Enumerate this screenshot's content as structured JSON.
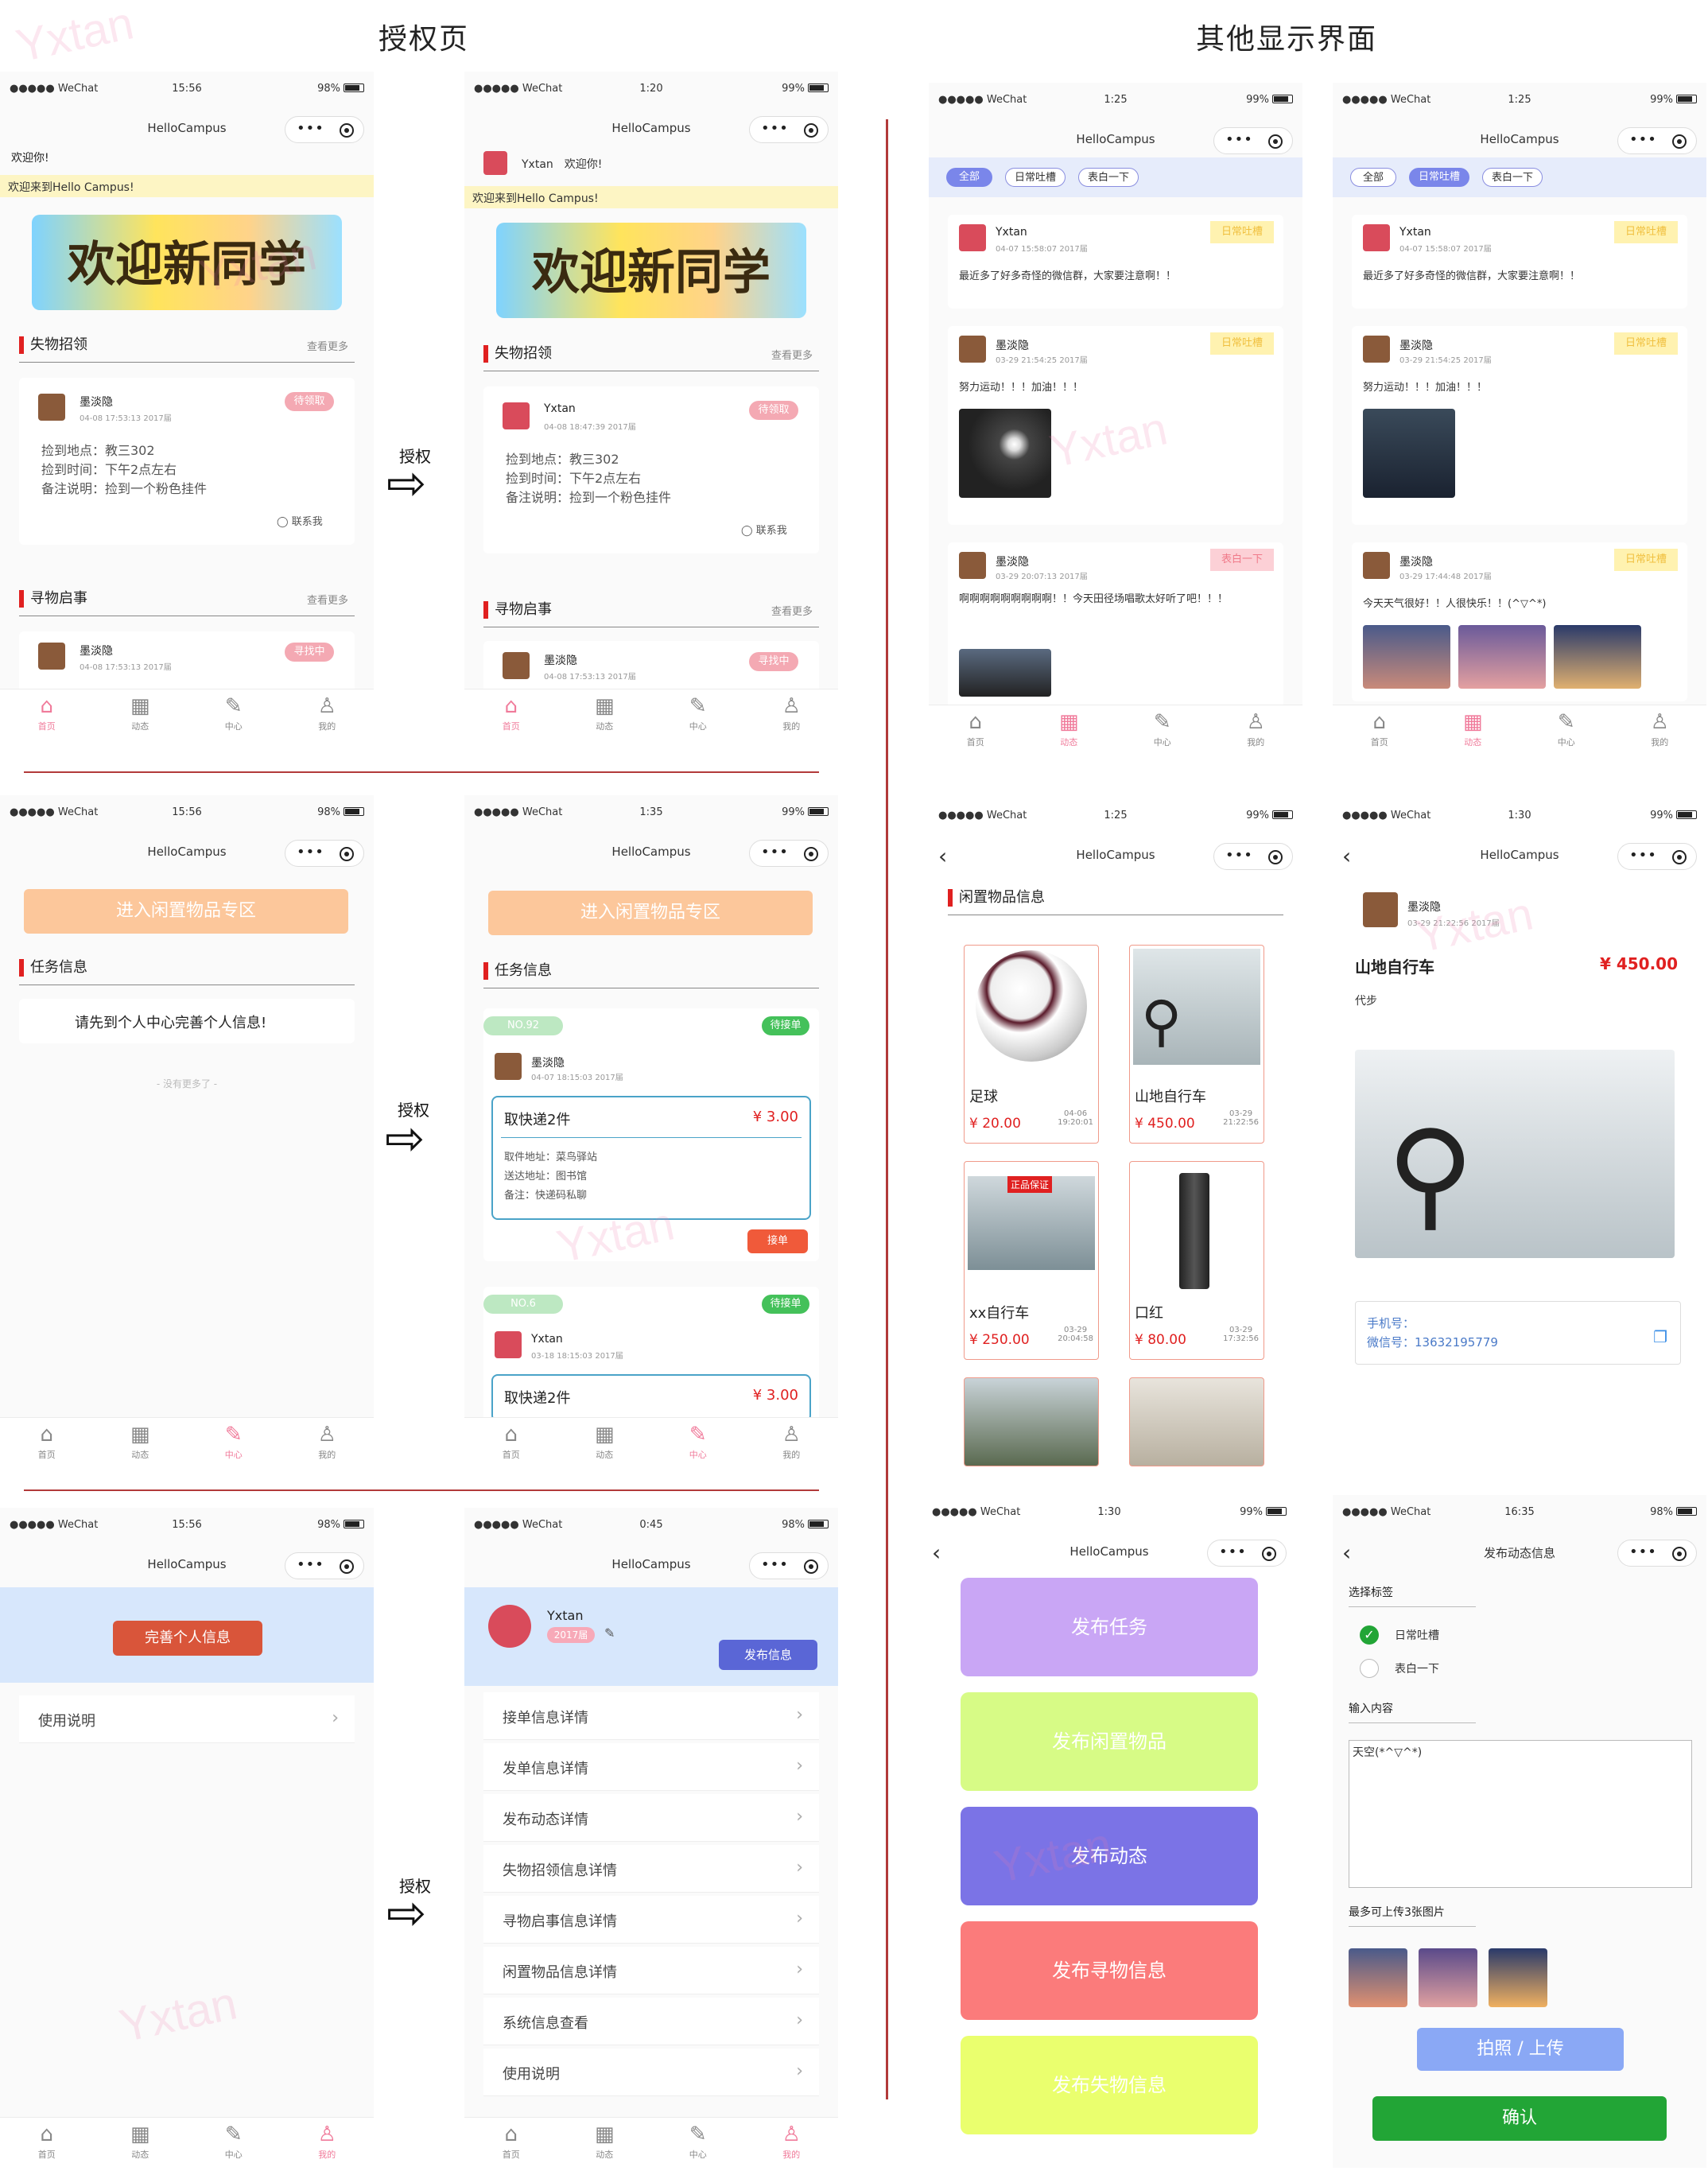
{
  "headings": {
    "auth": "授权页",
    "other": "其他显示界面"
  },
  "auth_label": "授权",
  "status": {
    "carrier": "●●●●● WeChat",
    "battery98": "98%",
    "battery99": "99%",
    "t1": "15:56",
    "t2": "1:20",
    "t3": "1:25",
    "t4": "1:35",
    "t5": "1:30",
    "t6": "0:45",
    "t7": "16:35"
  },
  "app_title": "HelloCampus",
  "tabs": {
    "home": "首页",
    "feed": "动态",
    "center": "中心",
    "mine": "我的"
  },
  "home": {
    "hello": "欢迎你!",
    "welcome": "欢迎来到Hello Campus!",
    "banner": "欢迎新同学",
    "lost_title": "失物招领",
    "find_title": "寻物启事",
    "more": "查看更多",
    "lost_user": "墨淡隐",
    "lost_time": "04-08 17:53:13 2017届",
    "lost_status": "待领取",
    "lost_place": "捡到地点：教三302",
    "lost_when": "捡到时间：下午2点左右",
    "lost_note": "备注说明：捡到一个粉色挂件",
    "contact": "联系我",
    "find_user": "墨淡隐",
    "find_time": "04-08 17:53:13 2017届",
    "find_status": "寻找中",
    "auth_user": "Yxtan",
    "auth_lost_time": "04-08 18:47:39 2017届",
    "auth_find_time": "04-08 17:53:13 2017届"
  },
  "feed": {
    "filter_all": "全部",
    "filter_daily": "日常吐槽",
    "filter_confess": "表白一下",
    "p1_user": "Yxtan",
    "p1_time": "04-07 15:58:07 2017届",
    "p1_tag": "日常吐槽",
    "p1_text": "最近多了好多奇怪的微信群，大家要注意啊！！",
    "p2_user": "墨淡隐",
    "p2_time": "03-29 21:54:25 2017届",
    "p2_tag": "日常吐槽",
    "p2_text": "努力运动！！！加油！！！",
    "p3_user": "墨淡隐",
    "p3_time": "03-29 20:07:13 2017届",
    "p3_tag": "表白一下",
    "p3_text": "啊啊啊啊啊啊啊啊啊！！今天田径场唱歌太好听了吧！！！",
    "p4_user": "墨淡隐",
    "p4_time": "03-29 17:44:48 2017届",
    "p4_tag": "日常吐槽",
    "p4_text": "今天天气很好！！人很快乐！！(^▽^*)"
  },
  "task": {
    "idle_btn": "进入闲置物品专区",
    "task_title": "任务信息",
    "hint": "请先到个人中心完善个人信息!",
    "no_more": "- 没有更多了 -",
    "no1": "NO.92",
    "st1": "待接单",
    "u1": "墨淡隐",
    "t1": "04-07 18:15:03 2017届",
    "n1": "取快递2件",
    "p1": "¥ 3.00",
    "from": "取件地址：菜鸟驿站",
    "to": "送达地址：图书馆",
    "note": "备注：快递码私聊",
    "accept": "接单",
    "no2": "NO.6",
    "st2": "待接单",
    "u2": "Yxtan",
    "t2": "03-18 18:15:03 2017届",
    "n2": "取快递2件",
    "p2": "¥ 3.00"
  },
  "idle": {
    "title": "闲置物品信息",
    "items": [
      {
        "name": "足球",
        "price": "¥ 20.00",
        "date": "04-06",
        "time": "19:20:01"
      },
      {
        "name": "山地自行车",
        "price": "¥ 450.00",
        "date": "03-29",
        "time": "21:22:56"
      },
      {
        "name": "xx自行车",
        "price": "¥ 250.00",
        "date": "03-29",
        "time": "20:04:58"
      },
      {
        "name": "口红",
        "price": "¥ 80.00",
        "date": "03-29",
        "time": "17:32:56"
      }
    ],
    "tag": "正品保证"
  },
  "detail": {
    "user": "墨淡隐",
    "time": "03-29 21:22:56 2017届",
    "title": "山地自行车",
    "price": "¥ 450.00",
    "desc": "代步",
    "phone": "手机号：",
    "wechat": "微信号：13632195779"
  },
  "mine": {
    "complete": "完善个人信息",
    "manual": "使用说明",
    "user": "Yxtan",
    "grade": "2017届",
    "publish": "发布信息",
    "rows": [
      "接单信息详情",
      "发单信息详情",
      "发布动态详情",
      "失物招领信息详情",
      "寻物启事信息详情",
      "闲置物品信息详情",
      "系统信息查看",
      "使用说明"
    ]
  },
  "publish": {
    "b1": "发布任务",
    "b2": "发布闲置物品",
    "b3": "发布动态",
    "b4": "发布寻物信息",
    "b5": "发布失物信息"
  },
  "post": {
    "nav": "发布动态信息",
    "choose": "选择标签",
    "opt1": "日常吐槽",
    "opt2": "表白一下",
    "input": "输入内容",
    "content": "天空(*^▽^*)",
    "upload_hint": "最多可上传3张图片",
    "upload": "拍照 / 上传",
    "confirm": "确认"
  },
  "watermark": "Yxtan",
  "colors": {
    "accent": "#f07a9a",
    "red": "#e02020",
    "purple": "#c9a6f5",
    "lime": "#d7fb86",
    "blue": "#7b73e6",
    "salmon": "#fb7b7b",
    "yellow": "#eaff6e",
    "green": "#22a536"
  }
}
